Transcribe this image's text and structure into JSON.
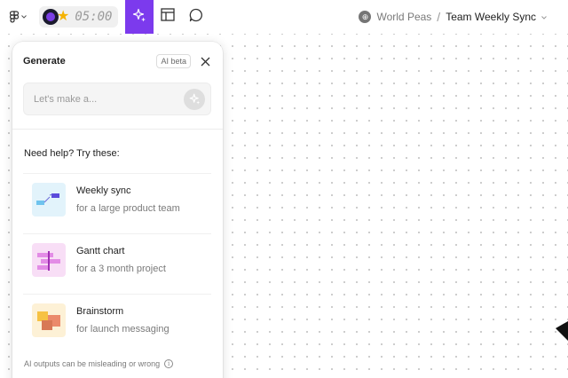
{
  "toolbar": {
    "timer": "05:00",
    "main_menu_icon": "figma-logo-icon",
    "tools": [
      "generate-sparkle-icon",
      "table-layout-icon",
      "comment-bubble-icon"
    ],
    "active_tool": "generate-sparkle-icon",
    "accent_color": "#7c3aed"
  },
  "breadcrumb": {
    "team": "World Peas",
    "separator": "/",
    "file": "Team Weekly Sync"
  },
  "panel": {
    "title": "Generate",
    "badge": "AI beta",
    "prompt_placeholder": "Let's make a...",
    "prompt_value": "",
    "help_label": "Need help? Try these:",
    "suggestions": [
      {
        "title": "Weekly sync",
        "subtitle": "for a large product team",
        "thumb_bg": "#e2f3fb"
      },
      {
        "title": "Gantt chart",
        "subtitle": "for a 3 month project",
        "thumb_bg": "#f8def6"
      },
      {
        "title": "Brainstorm",
        "subtitle": "for launch messaging",
        "thumb_bg": "#fdf1d6"
      }
    ],
    "disclaimer": "AI outputs can be misleading or wrong"
  }
}
